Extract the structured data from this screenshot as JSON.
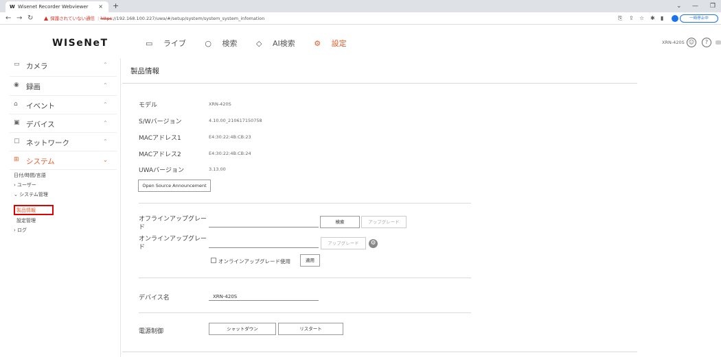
{
  "browser": {
    "tab_title": "Wisenet Recorder Webviewer",
    "tab_favicon": "W",
    "tab_close": "×",
    "new_tab": "+",
    "security_warning": "保護されていない通信",
    "url_protocol": "https",
    "url_rest": "://192.168.100.227/uwa/#/setup/system/system_system_infomation",
    "paused_label": "一時停止中",
    "profile_label": "有"
  },
  "header": {
    "logo": "WISeNeT",
    "nav": {
      "live": "ライブ",
      "search": "検索",
      "ai_search": "AI検索",
      "settings": "設定"
    },
    "model": "XRN-420S",
    "icons": {
      "user": "user-icon",
      "help": "help-icon"
    }
  },
  "sidebar": {
    "menus": [
      {
        "label": "カメラ",
        "icon": "camera-icon",
        "glyph": "▭",
        "chevron": "⌃"
      },
      {
        "label": "録画",
        "icon": "record-icon",
        "glyph": "◉",
        "chevron": "⌃"
      },
      {
        "label": "イベント",
        "icon": "bell-icon",
        "glyph": "⌂",
        "chevron": "⌃"
      },
      {
        "label": "デバイス",
        "icon": "device-icon",
        "glyph": "▣",
        "chevron": "⌃"
      },
      {
        "label": "ネットワーク",
        "icon": "network-icon",
        "glyph": "▢",
        "chevron": "⌃"
      },
      {
        "label": "システム",
        "icon": "system-icon",
        "glyph": "⊞",
        "chevron": "⌄"
      }
    ],
    "sub": {
      "datetime": "日付/時間/言語",
      "user": "ユーザー",
      "system_mgmt": "システム管理",
      "product_info": "製品情報",
      "settings_mgmt": "設定管理",
      "log": "ログ"
    }
  },
  "main": {
    "page_title": "製品情報",
    "info": [
      {
        "label": "モデル",
        "value": "XRN-420S"
      },
      {
        "label": "S/Wバージョン",
        "value": "4.10.00_210617150758"
      },
      {
        "label": "MACアドレス1",
        "value": "E4:30:22:4B:CB:23"
      },
      {
        "label": "MACアドレス2",
        "value": "E4:30:22:4B:CB:24"
      },
      {
        "label": "UWAバージョン",
        "value": "3.13.00"
      }
    ],
    "open_source_button": "Open Source Announcement",
    "offline_upgrade_label_1": "オフラインアップグレー",
    "offline_upgrade_label_2": "ド",
    "online_upgrade_label_1": "オンラインアップグレー",
    "online_upgrade_label_2": "ド",
    "browse_button": "検索",
    "upgrade_button": "アップグレード",
    "online_upgrade_button": "アップグレード",
    "use_online_upgrade": "オンラインアップグレード使用",
    "apply_button": "適用",
    "device_name_label": "デバイス名",
    "device_name_value": "XRN-420S",
    "power_label": "電源制御",
    "shutdown_button": "シャットダウン",
    "restart_button": "リスタート"
  }
}
